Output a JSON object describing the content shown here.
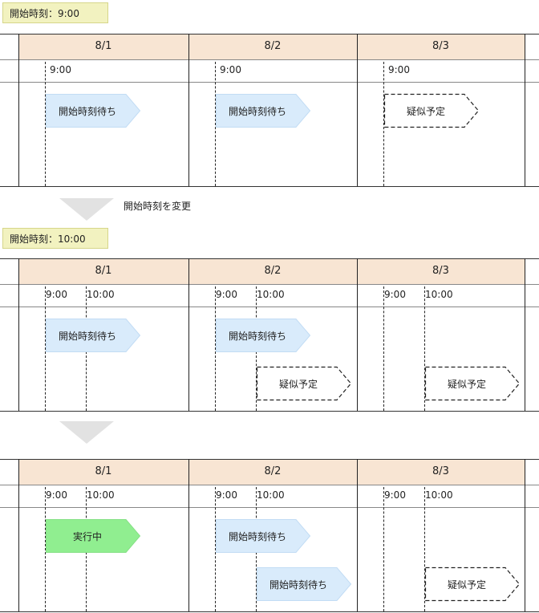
{
  "labels": {
    "start_9": "開始時刻：9:00",
    "start_10": "開始時刻：10:00",
    "change_caption": "開始時刻を変更"
  },
  "days": [
    "8/1",
    "8/2",
    "8/3"
  ],
  "times": {
    "t9": "9:00",
    "t10": "10:00"
  },
  "states": {
    "waiting": "開始時刻待ち",
    "pseudo": "疑似予定",
    "running": "実行中"
  },
  "colors": {
    "header": "#f8e5d3",
    "label_box": "#f2f2c0",
    "waiting_fill": "#d9ebfb",
    "running_fill": "#90ee90",
    "arrow": "#e2e2e2"
  },
  "panels": [
    {
      "start_label": "開始時刻：9:00",
      "markers": [
        "9:00"
      ],
      "jobs": [
        {
          "day": "8/1",
          "state": "開始時刻待ち",
          "at": "9:00"
        },
        {
          "day": "8/2",
          "state": "開始時刻待ち",
          "at": "9:00"
        },
        {
          "day": "8/3",
          "state": "疑似予定",
          "at": "9:00"
        }
      ]
    },
    {
      "start_label": "開始時刻：10:00",
      "markers": [
        "9:00",
        "10:00"
      ],
      "jobs": [
        {
          "day": "8/1",
          "state": "開始時刻待ち",
          "at": "9:00"
        },
        {
          "day": "8/2",
          "state": "開始時刻待ち",
          "at": "9:00"
        },
        {
          "day": "8/2",
          "state": "疑似予定",
          "at": "10:00"
        },
        {
          "day": "8/3",
          "state": "疑似予定",
          "at": "10:00"
        }
      ]
    },
    {
      "start_label": "",
      "markers": [
        "9:00",
        "10:00"
      ],
      "jobs": [
        {
          "day": "8/1",
          "state": "実行中",
          "at": "9:00"
        },
        {
          "day": "8/2",
          "state": "開始時刻待ち",
          "at": "9:00"
        },
        {
          "day": "8/2",
          "state": "開始時刻待ち",
          "at": "10:00"
        },
        {
          "day": "8/3",
          "state": "疑似予定",
          "at": "10:00"
        }
      ]
    }
  ]
}
